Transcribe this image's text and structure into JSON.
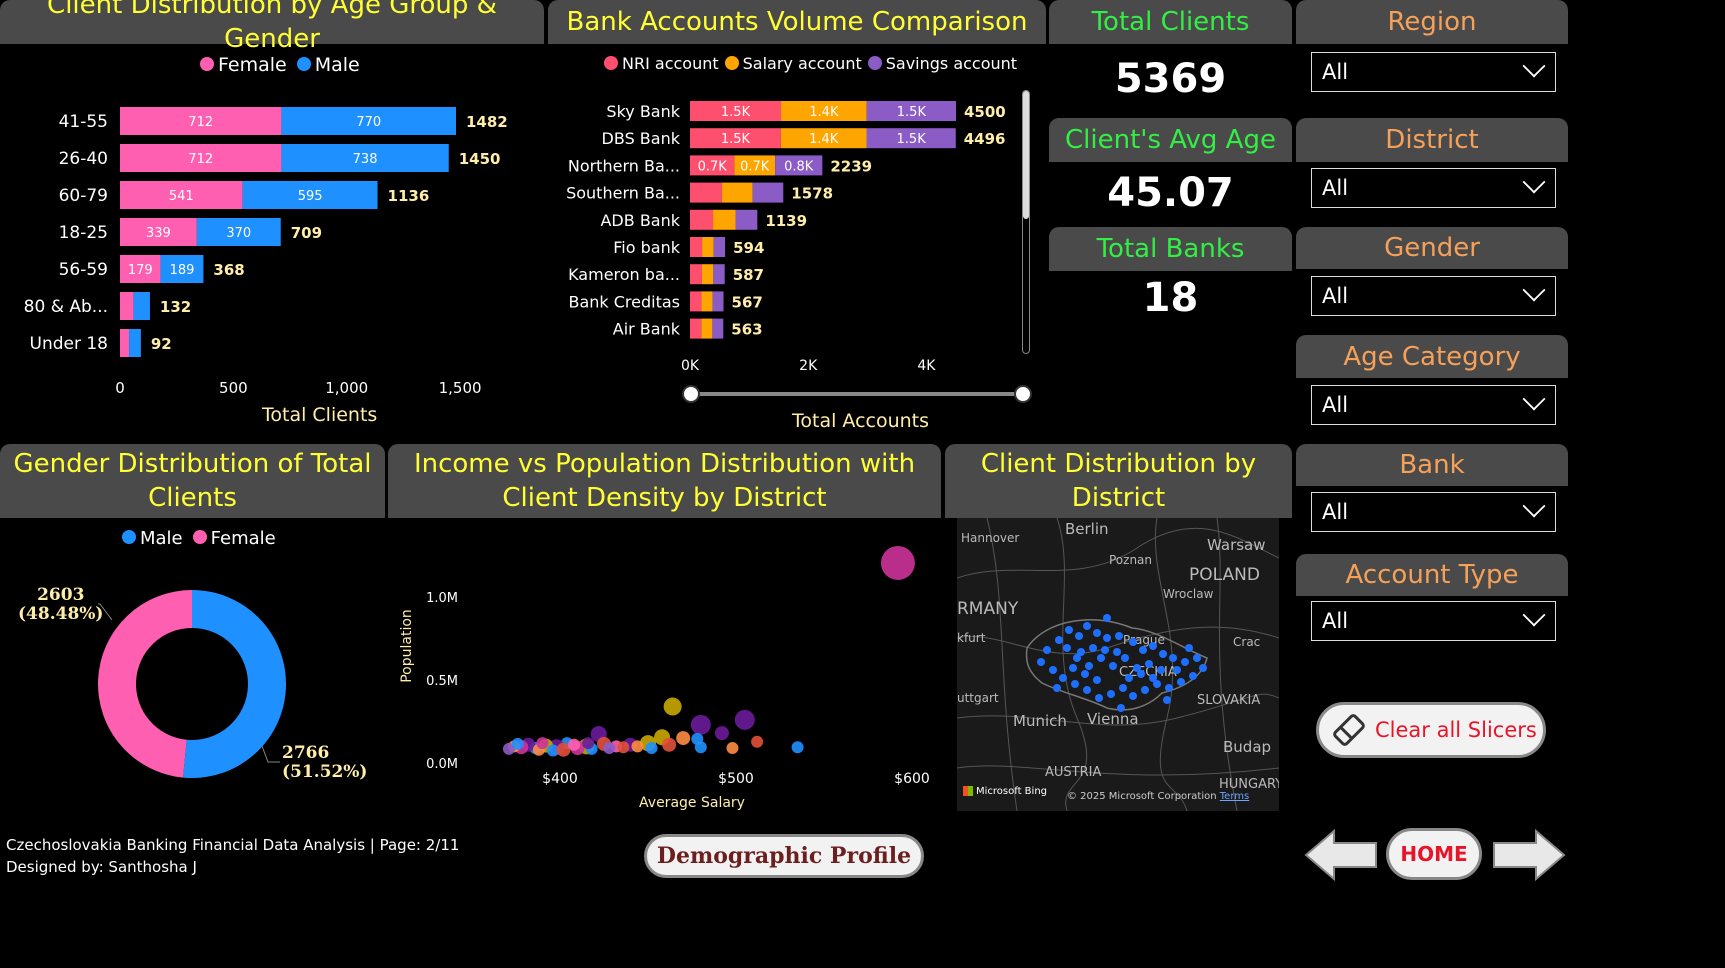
{
  "age_gender": {
    "title": "Client Distribution by Age Group & Gender",
    "legend": [
      {
        "label": "Female",
        "color": "#ff5fb0"
      },
      {
        "label": "Male",
        "color": "#1e90ff"
      }
    ],
    "xlabel": "Total Clients",
    "ticks": [
      "0",
      "500",
      "1,000",
      "1,500"
    ]
  },
  "accounts": {
    "title": "Bank Accounts Volume Comparison",
    "legend": [
      {
        "label": "NRI account",
        "color": "#ff4f6e"
      },
      {
        "label": "Salary account",
        "color": "#ffa500"
      },
      {
        "label": "Savings account",
        "color": "#8b5bc6"
      }
    ],
    "xlabel": "Total Accounts",
    "ticks": [
      "0K",
      "2K",
      "4K"
    ]
  },
  "kpis": {
    "total_clients_label": "Total Clients",
    "total_clients_value": "5369",
    "avg_age_label": "Client's Avg Age",
    "avg_age_value": "45.07",
    "total_banks_label": "Total Banks",
    "total_banks_value": "18"
  },
  "slicers": [
    {
      "label": "Region",
      "value": "All"
    },
    {
      "label": "District",
      "value": "All"
    },
    {
      "label": "Gender",
      "value": "All"
    },
    {
      "label": "Age Category",
      "value": "All"
    },
    {
      "label": "Bank",
      "value": "All"
    },
    {
      "label": "Account Type",
      "value": "All"
    }
  ],
  "gender_pie": {
    "title": "Gender Distribution of Total Clients",
    "legend": [
      {
        "label": "Male",
        "color": "#1e90ff"
      },
      {
        "label": "Female",
        "color": "#ff5fb0"
      }
    ],
    "female_label": "2603",
    "female_pct": "(48.48%)",
    "male_label": "2766",
    "male_pct": "(51.52%)"
  },
  "scatter": {
    "title": "Income vs Population Distribution with Client Density by District",
    "xlabel": "Average Salary",
    "ylabel": "Population",
    "xticks": [
      "$400",
      "$500",
      "$600"
    ],
    "yticks": [
      "1.0M",
      "0.5M",
      "0.0M"
    ]
  },
  "map": {
    "title": "Client Distribution by District",
    "labels": [
      "Berlin",
      "Hannover",
      "Poznan",
      "Warsaw",
      "POLAND",
      "Wroclaw",
      "RMANY",
      "kfurt",
      "Prague",
      "Crac",
      "CZECHIA",
      "uttgart",
      "SLOVAKIA",
      "Munich",
      "Vienna",
      "Budap",
      "AUSTRIA",
      "HUNGARY"
    ],
    "bing": "Microsoft Bing",
    "copyright": "© 2025 Microsoft Corporation",
    "terms": "Terms"
  },
  "footer": {
    "line1": "Czechoslovakia Banking Financial Data Analysis | Page: 2/11",
    "line2": "Designed by: Santhosha J",
    "page_button": "Demographic Profile",
    "clear_button": "Clear all Slicers",
    "home_button": "HOME"
  },
  "chart_data": [
    {
      "type": "bar",
      "title": "Client Distribution by Age Group & Gender",
      "xlabel": "Total Clients",
      "xlim": [
        0,
        1700
      ],
      "categories": [
        "41-55",
        "26-40",
        "60-79",
        "18-25",
        "56-59",
        "80 & Ab...",
        "Under 18"
      ],
      "series": [
        {
          "name": "Female",
          "values": [
            712,
            712,
            541,
            339,
            179,
            60,
            40
          ]
        },
        {
          "name": "Male",
          "values": [
            770,
            738,
            595,
            370,
            189,
            72,
            52
          ]
        }
      ],
      "totals": [
        1482,
        1450,
        1136,
        709,
        368,
        132,
        92
      ],
      "data_labels": [
        {
          "female": "712",
          "male": "770"
        },
        {
          "female": "712",
          "male": "738"
        },
        {
          "female": "541",
          "male": "595"
        },
        {
          "female": "339",
          "male": "370"
        },
        {
          "female": "179",
          "male": "189"
        },
        {
          "female": "",
          "male": ""
        },
        {
          "female": "",
          "male": ""
        }
      ]
    },
    {
      "type": "bar",
      "title": "Bank Accounts Volume Comparison",
      "xlabel": "Total Accounts",
      "xlim": [
        0,
        5000
      ],
      "categories": [
        "Sky Bank",
        "DBS Bank",
        "Northern Ba...",
        "Southern Ba...",
        "ADB Bank",
        "Fio bank",
        "Kameron ba...",
        "Bank Creditas",
        "Air Bank"
      ],
      "series": [
        {
          "name": "NRI account",
          "values": [
            1540,
            1538,
            750,
            540,
            390,
            205,
            202,
            195,
            193
          ],
          "labels": [
            "1.5K",
            "1.5K",
            "0.7K",
            "",
            "",
            "",
            "",
            "",
            ""
          ]
        },
        {
          "name": "Salary account",
          "values": [
            1450,
            1448,
            690,
            520,
            380,
            195,
            193,
            187,
            186
          ],
          "labels": [
            "1.4K",
            "1.4K",
            "0.7K",
            "",
            "",
            "",
            "",
            "",
            ""
          ]
        },
        {
          "name": "Savings account",
          "values": [
            1510,
            1510,
            799,
            518,
            369,
            194,
            192,
            185,
            184
          ],
          "labels": [
            "1.5K",
            "1.5K",
            "0.8K",
            "",
            "",
            "",
            "",
            "",
            ""
          ]
        }
      ],
      "totals": [
        4500,
        4496,
        2239,
        1578,
        1139,
        594,
        587,
        567,
        563
      ]
    },
    {
      "type": "pie",
      "title": "Gender Distribution of Total Clients",
      "categories": [
        "Male",
        "Female"
      ],
      "values": [
        2766,
        2603
      ]
    },
    {
      "type": "scatter",
      "title": "Income vs Population Distribution with Client Density by District",
      "xlabel": "Average Salary",
      "ylabel": "Population",
      "xlim": [
        360,
        640
      ],
      "ylim": [
        0,
        1250000
      ],
      "points": [
        {
          "x": 592,
          "y": 1205000,
          "r": 17,
          "c": "#cc3399"
        },
        {
          "x": 464,
          "y": 340000,
          "r": 9,
          "c": "#c9a800"
        },
        {
          "x": 480,
          "y": 230000,
          "r": 10,
          "c": "#6a1b9a"
        },
        {
          "x": 505,
          "y": 260000,
          "r": 10,
          "c": "#6a1b9a"
        },
        {
          "x": 422,
          "y": 175000,
          "r": 8,
          "c": "#6a1b9a"
        },
        {
          "x": 458,
          "y": 155000,
          "r": 8,
          "c": "#c9a800"
        },
        {
          "x": 470,
          "y": 150000,
          "r": 7,
          "c": "#ff8c42"
        },
        {
          "x": 478,
          "y": 145000,
          "r": 6,
          "c": "#1e90ff"
        },
        {
          "x": 492,
          "y": 180000,
          "r": 7,
          "c": "#6a1b9a"
        },
        {
          "x": 512,
          "y": 128000,
          "r": 6,
          "c": "#e0503a"
        },
        {
          "x": 535,
          "y": 95000,
          "r": 6,
          "c": "#1e90ff"
        },
        {
          "x": 498,
          "y": 90000,
          "r": 6,
          "c": "#ff8c42"
        },
        {
          "x": 480,
          "y": 95000,
          "r": 6,
          "c": "#1e90ff"
        },
        {
          "x": 462,
          "y": 110000,
          "r": 7,
          "c": "#e0503a"
        },
        {
          "x": 450,
          "y": 120000,
          "r": 8,
          "c": "#c9a800"
        },
        {
          "x": 440,
          "y": 110000,
          "r": 7,
          "c": "#6a1b9a"
        },
        {
          "x": 432,
          "y": 100000,
          "r": 6,
          "c": "#ff5fb0"
        },
        {
          "x": 425,
          "y": 115000,
          "r": 7,
          "c": "#e0503a"
        },
        {
          "x": 415,
          "y": 100000,
          "r": 8,
          "c": "#c9a800"
        },
        {
          "x": 410,
          "y": 90000,
          "r": 7,
          "c": "#cc3399"
        },
        {
          "x": 404,
          "y": 120000,
          "r": 6,
          "c": "#1e90ff"
        },
        {
          "x": 398,
          "y": 95000,
          "r": 8,
          "c": "#6a1b9a"
        },
        {
          "x": 392,
          "y": 105000,
          "r": 7,
          "c": "#c9a800"
        },
        {
          "x": 386,
          "y": 90000,
          "r": 6,
          "c": "#1e90ff"
        },
        {
          "x": 382,
          "y": 110000,
          "r": 7,
          "c": "#6a1b9a"
        },
        {
          "x": 378,
          "y": 95000,
          "r": 7,
          "c": "#cc3399"
        },
        {
          "x": 374,
          "y": 100000,
          "r": 6,
          "c": "#ff8c42"
        },
        {
          "x": 371,
          "y": 85000,
          "r": 6,
          "c": "#8b5bc6"
        },
        {
          "x": 388,
          "y": 80000,
          "r": 6,
          "c": "#ff8c42"
        },
        {
          "x": 396,
          "y": 75000,
          "r": 6,
          "c": "#1e90ff"
        },
        {
          "x": 402,
          "y": 80000,
          "r": 7,
          "c": "#e0503a"
        },
        {
          "x": 408,
          "y": 110000,
          "r": 6,
          "c": "#ff5fb0"
        },
        {
          "x": 418,
          "y": 85000,
          "r": 6,
          "c": "#1e90ff"
        },
        {
          "x": 428,
          "y": 90000,
          "r": 6,
          "c": "#8b5bc6"
        },
        {
          "x": 436,
          "y": 95000,
          "r": 6,
          "c": "#e0503a"
        },
        {
          "x": 444,
          "y": 100000,
          "r": 6,
          "c": "#ff8c42"
        },
        {
          "x": 452,
          "y": 90000,
          "r": 6,
          "c": "#1e90ff"
        },
        {
          "x": 416,
          "y": 120000,
          "r": 6,
          "c": "#6a1b9a"
        },
        {
          "x": 390,
          "y": 120000,
          "r": 6,
          "c": "#cc3399"
        },
        {
          "x": 376,
          "y": 115000,
          "r": 6,
          "c": "#1e90ff"
        }
      ]
    }
  ]
}
